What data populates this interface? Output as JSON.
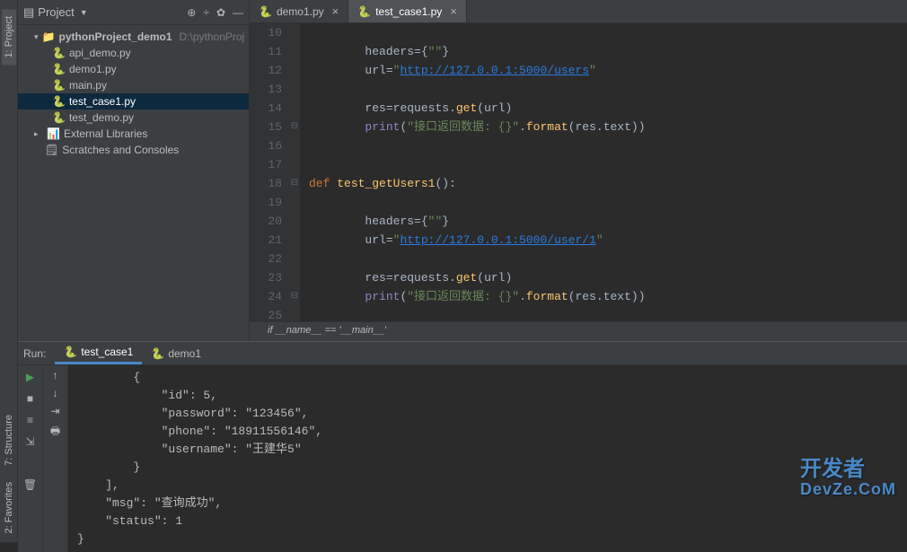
{
  "sidebar": {
    "tabs": [
      "1: Project",
      "7: Structure",
      "2: Favorites"
    ]
  },
  "project": {
    "title": "Project",
    "root": {
      "name": "pythonProject_demo1",
      "path": "D:\\pythonProj"
    },
    "files": [
      "api_demo.py",
      "demo1.py",
      "main.py",
      "test_case1.py",
      "test_demo.py"
    ],
    "external": "External Libraries",
    "scratches": "Scratches and Consoles"
  },
  "editor": {
    "tabs": [
      {
        "name": "demo1.py",
        "active": false
      },
      {
        "name": "test_case1.py",
        "active": true
      }
    ],
    "active_file": "test_case1.py",
    "line_start": 10,
    "line_end": 25,
    "breadcrumb": "if __name__ == '__main__'",
    "code": {
      "url1": "http://127.0.0.1:5000/users",
      "url2": "http://127.0.0.1:5000/user/1",
      "print_str": "接口返回数据: {}",
      "func_name": "test_getUsers1",
      "headers": "headers",
      "url": "url",
      "res": "res",
      "requests": "requests",
      "get": "get",
      "print": "print",
      "format": "format",
      "text": "text",
      "def": "def"
    }
  },
  "run": {
    "label": "Run:",
    "tabs": [
      "test_case1",
      "demo1"
    ],
    "output": "        {\n            \"id\": 5,\n            \"password\": \"123456\",\n            \"phone\": \"18911556146\",\n            \"username\": \"王建华5\"\n        }\n    ],\n    \"msg\": \"查询成功\",\n    \"status\": 1\n}"
  },
  "watermark": {
    "l1": "开发者",
    "l2": "DevZe.CoM"
  }
}
